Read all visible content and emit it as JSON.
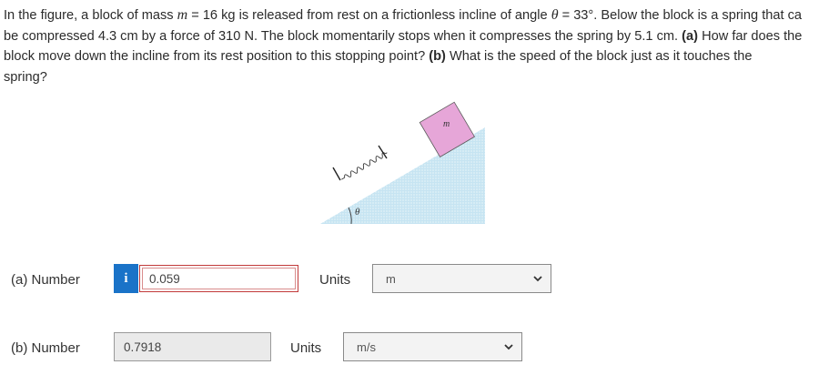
{
  "problem": {
    "line1_a": "In the figure, a block of mass ",
    "line1_m": "m",
    "line1_b": " = 16 kg is released from rest on a frictionless incline of angle ",
    "line1_theta": "θ",
    "line1_c": " = 33°. Below the block is a spring that ca",
    "line2_a": "be compressed 4.3 cm by a force of 310 N. The block momentarily stops when it compresses the spring by 5.1 cm. ",
    "line2_b": "(a)",
    "line2_c": " How far does the",
    "line3_a": "block move down the incline from its rest position to this stopping point? ",
    "line3_b": "(b)",
    "line3_c": " What is the speed of the block just as it touches the",
    "line4": "spring?"
  },
  "figure": {
    "block_label": "m",
    "angle_label": "θ",
    "colors": {
      "block": "#e6a6d8",
      "incline": "#c6e4f2"
    }
  },
  "part_a": {
    "label": "(a)   Number",
    "info_icon": "i",
    "value": "0.059",
    "units_label": "Units",
    "units_value": "m"
  },
  "part_b": {
    "label": "(b)   Number",
    "value": "0.7918",
    "units_label": "Units",
    "units_value": "m/s"
  }
}
